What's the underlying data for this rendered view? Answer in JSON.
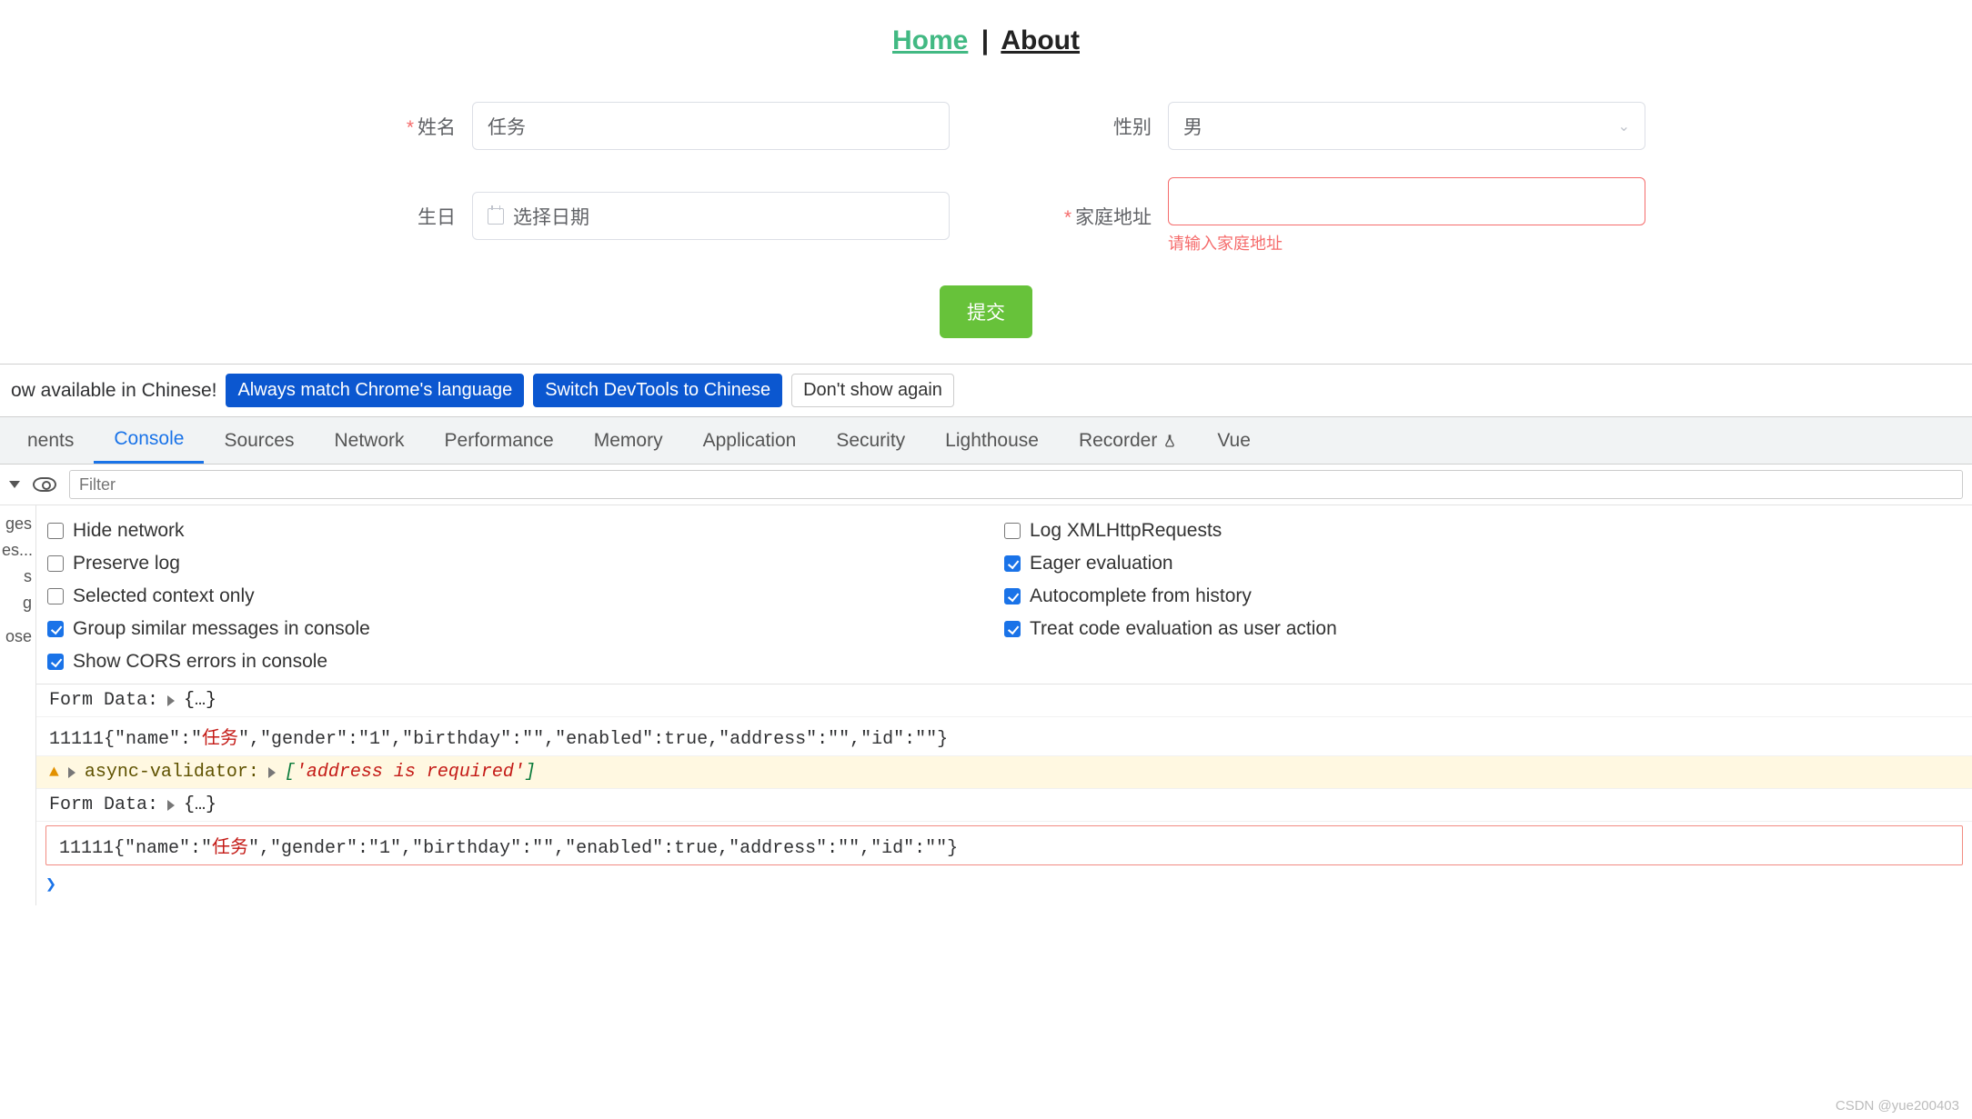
{
  "nav": {
    "home": "Home",
    "sep": "|",
    "about": "About"
  },
  "form": {
    "name": {
      "label": "姓名",
      "value": "任务"
    },
    "gender": {
      "label": "性别",
      "value": "男"
    },
    "birthday": {
      "label": "生日",
      "placeholder": "选择日期"
    },
    "address": {
      "label": "家庭地址",
      "value": "",
      "error": "请输入家庭地址"
    },
    "submit": "提交"
  },
  "devtools": {
    "banner": {
      "msg": "ow available in Chinese!",
      "btn_match": "Always match Chrome's language",
      "btn_switch": "Switch DevTools to Chinese",
      "btn_dismiss": "Don't show again"
    },
    "tabs": [
      "nents",
      "Console",
      "Sources",
      "Network",
      "Performance",
      "Memory",
      "Application",
      "Security",
      "Lighthouse",
      "Recorder",
      "Vue"
    ],
    "active_tab": "Console",
    "toolbar": {
      "filter_placeholder": "Filter"
    },
    "sidebar": [
      "ges",
      "es...",
      "s",
      "g",
      "",
      "ose"
    ],
    "options_left": [
      {
        "label": "Hide network",
        "checked": false
      },
      {
        "label": "Preserve log",
        "checked": false
      },
      {
        "label": "Selected context only",
        "checked": false
      },
      {
        "label": "Group similar messages in console",
        "checked": true
      },
      {
        "label": "Show CORS errors in console",
        "checked": true
      }
    ],
    "options_right": [
      {
        "label": "Log XMLHttpRequests",
        "checked": false
      },
      {
        "label": "Eager evaluation",
        "checked": true
      },
      {
        "label": "Autocomplete from history",
        "checked": true
      },
      {
        "label": "Treat code evaluation as user action",
        "checked": true
      }
    ],
    "logs": {
      "l1_label": "Form Data: ",
      "l1_obj": "{…}",
      "l2_prefix": "11111{\"name\":\"",
      "l2_cjk": "任务",
      "l2_suffix": "\",\"gender\":\"1\",\"birthday\":\"\",\"enabled\":true,\"address\":\"\",\"id\":\"\"}",
      "l3_src": "async-validator:",
      "l3_arr_open": "[",
      "l3_arr_msg": "'address is required'",
      "l3_arr_close": "]",
      "l4_label": "Form Data: ",
      "l4_obj": "{…}",
      "l5_prefix": "11111{\"name\":\"",
      "l5_cjk": "任务",
      "l5_suffix": "\",\"gender\":\"1\",\"birthday\":\"\",\"enabled\":true,\"address\":\"\",\"id\":\"\"}"
    },
    "prompt": "❯"
  },
  "watermark": "CSDN @yue200403"
}
